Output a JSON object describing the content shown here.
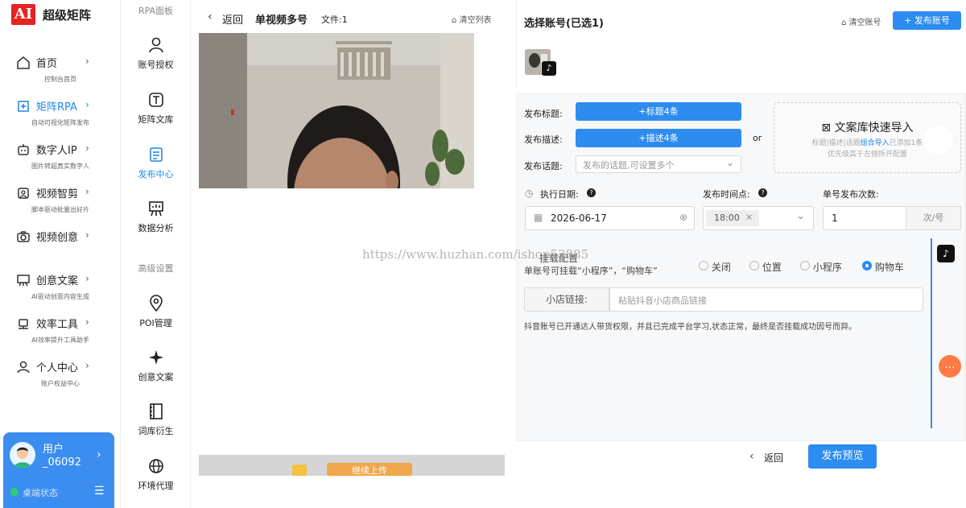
{
  "brand": {
    "logo": "AI",
    "name": "超级矩阵"
  },
  "sidebar": {
    "items": [
      {
        "label": "首页",
        "sub": "控制台首页",
        "icon": "home-icon"
      },
      {
        "label": "矩阵RPA",
        "sub": "自动可视化矩阵发布",
        "icon": "send-icon"
      },
      {
        "label": "数字人IP",
        "sub": "图片转超真实数字人",
        "icon": "robot-icon"
      },
      {
        "label": "视频智剪",
        "sub": "脚本驱动批量出好片",
        "icon": "video-clip-icon"
      },
      {
        "label": "视频创意",
        "sub": "",
        "icon": "camera-icon"
      },
      {
        "label": "创意文案",
        "sub": "AI驱动创意内容生成",
        "icon": "board-icon"
      },
      {
        "label": "效率工具",
        "sub": "AI效率提升工具助手",
        "icon": "tools-icon"
      },
      {
        "label": "个人中心",
        "sub": "账户权益中心",
        "icon": "user-icon"
      }
    ],
    "user": {
      "name": "用户",
      "id": "_06092",
      "status": "桌端状态"
    }
  },
  "rpa": {
    "header": "RPA面板",
    "advanced": "高级设置",
    "items": [
      {
        "label": "账号授权",
        "icon": "user-auth-icon"
      },
      {
        "label": "矩阵文库",
        "icon": "library-icon"
      },
      {
        "label": "发布中心",
        "icon": "publish-icon"
      },
      {
        "label": "数据分析",
        "icon": "chart-board-icon"
      },
      {
        "label": "POI管理",
        "icon": "location-pin-icon"
      },
      {
        "label": "创意文案",
        "icon": "sparkle-icon"
      },
      {
        "label": "词库衍生",
        "icon": "notebook-icon"
      },
      {
        "label": "环境代理",
        "icon": "globe-icon"
      }
    ]
  },
  "editor": {
    "back": "返回",
    "title": "单视频多号",
    "file_count": "文件:1",
    "clear_list": "清空列表",
    "continue_upload": "继续上传"
  },
  "accounts": {
    "title": "选择账号(已选1)",
    "clear": "清空账号",
    "publish": "+ 发布账号"
  },
  "form": {
    "title_label": "发布标题:",
    "title_btn": "+标题4条",
    "desc_label": "发布描述:",
    "desc_btn": "+描述4条",
    "topic_label": "发布话题:",
    "topic_placeholder": "发布的话题,可设置多个",
    "or": "or",
    "import_title": "文案库快速导入",
    "import_desc1_a": "标题|描述|话题",
    "import_desc1_b": "组合导入",
    "import_desc1_c": "已添加1条",
    "import_desc2": "优先级高于左侧拆开配置",
    "exec_date_label": "执行日期:",
    "exec_date": "2026-06-17",
    "time_label": "发布时间点:",
    "time_value": "18:00",
    "count_label": "单号发布次数:",
    "count_value": "1",
    "count_unit": "次/号",
    "mount_title": "挂载配置",
    "mount_hint": "单账号可挂载“小程序”，“购物车”",
    "mount_options": [
      "关闭",
      "位置",
      "小程序",
      "购物车"
    ],
    "mount_selected": "购物车",
    "shop_label": "小店链接:",
    "shop_placeholder": "粘贴抖音小店商品链接",
    "shop_note": "抖音账号已开通达人带货权限，并且已完成平台学习,状态正常，最终是否挂载成功因号而异。"
  },
  "footer": {
    "back": "返回",
    "preview": "发布预览"
  },
  "watermark": "https://www.huzhan.com/ishop53885",
  "colors": {
    "primary": "#2d8cf0",
    "logo": "#e32424",
    "chat": "#ff7a45"
  }
}
